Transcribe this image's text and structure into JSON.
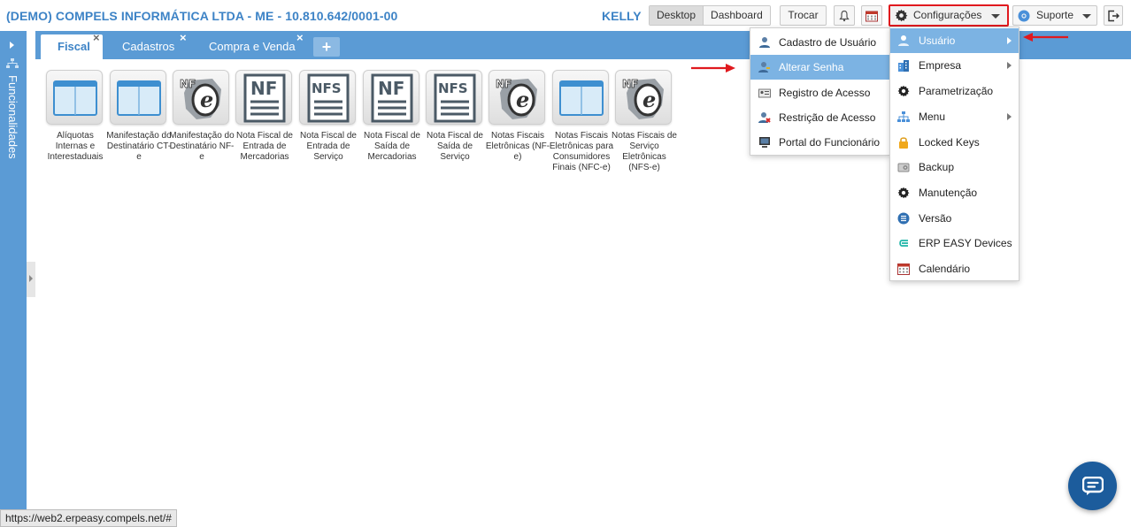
{
  "header": {
    "company": "(DEMO) COMPELS INFORMÁTICA LTDA - ME - 10.810.642/0001-00",
    "user": "KELLY",
    "view_desktop": "Desktop",
    "view_dashboard": "Dashboard",
    "trocar": "Trocar",
    "config_label": "Configurações",
    "support_label": "Suporte"
  },
  "sidebar": {
    "label": "Funcionalidades"
  },
  "tabs": [
    {
      "label": "Fiscal"
    },
    {
      "label": "Cadastros"
    },
    {
      "label": "Compra e Venda"
    }
  ],
  "modules": [
    {
      "label": "Alíquotas Internas e Interestaduais",
      "icon": "window-icon"
    },
    {
      "label": "Manifestação do Destinatário CT-e",
      "icon": "window-icon"
    },
    {
      "label": "Manifestação do Destinatário NF-e",
      "icon": "nfe-icon"
    },
    {
      "label": "Nota Fiscal de Entrada de Mercadorias",
      "icon": "nf-document-icon"
    },
    {
      "label": "Nota Fiscal de Entrada de Serviço",
      "icon": "nfs-document-icon"
    },
    {
      "label": "Nota Fiscal de Saída de Mercadorias",
      "icon": "nf-document-icon"
    },
    {
      "label": "Nota Fiscal de Saída de Serviço",
      "icon": "nfs-document-icon"
    },
    {
      "label": "Notas Fiscais Eletrônicas (NF-e)",
      "icon": "nfe-icon"
    },
    {
      "label": "Notas Fiscais Eletrônicas para Consumidores Finais (NFC-e)",
      "icon": "window-icon"
    },
    {
      "label": "Notas Fiscais de Serviço Eletrônicas (NFS-e)",
      "icon": "nfe-icon"
    }
  ],
  "config_menu": [
    {
      "label": "Usuário",
      "icon": "user-icon",
      "submenu": true,
      "highlighted": true
    },
    {
      "label": "Empresa",
      "icon": "building-icon",
      "submenu": true
    },
    {
      "label": "Parametrização",
      "icon": "gear-icon",
      "submenu": false
    },
    {
      "label": "Menu",
      "icon": "sitemap-icon",
      "submenu": true
    },
    {
      "label": "Locked Keys",
      "icon": "lock-icon",
      "submenu": false
    },
    {
      "label": "Backup",
      "icon": "backup-icon",
      "submenu": false
    },
    {
      "label": "Manutenção",
      "icon": "gear-icon",
      "submenu": false
    },
    {
      "label": "Versão",
      "icon": "list-circle-icon",
      "submenu": false
    },
    {
      "label": "ERP EASY Devices",
      "icon": "devices-icon",
      "submenu": false
    },
    {
      "label": "Calendário",
      "icon": "calendar-icon",
      "submenu": false
    }
  ],
  "user_submenu": [
    {
      "label": "Cadastro de Usuário",
      "icon": "user-icon"
    },
    {
      "label": "Alterar Senha",
      "icon": "user-key-icon",
      "highlighted": true
    },
    {
      "label": "Registro de Acesso",
      "icon": "id-card-icon"
    },
    {
      "label": "Restrição de Acesso",
      "icon": "user-block-icon"
    },
    {
      "label": "Portal do Funcionário",
      "icon": "monitor-icon"
    }
  ],
  "status_url": "https://web2.erpeasy.compels.net/#",
  "colors": {
    "primary": "#5b9bd5",
    "accent_text": "#3d83c6",
    "highlight": "#7cb3e3",
    "annotation_red": "#e0191e",
    "chat": "#1c5c9c"
  }
}
